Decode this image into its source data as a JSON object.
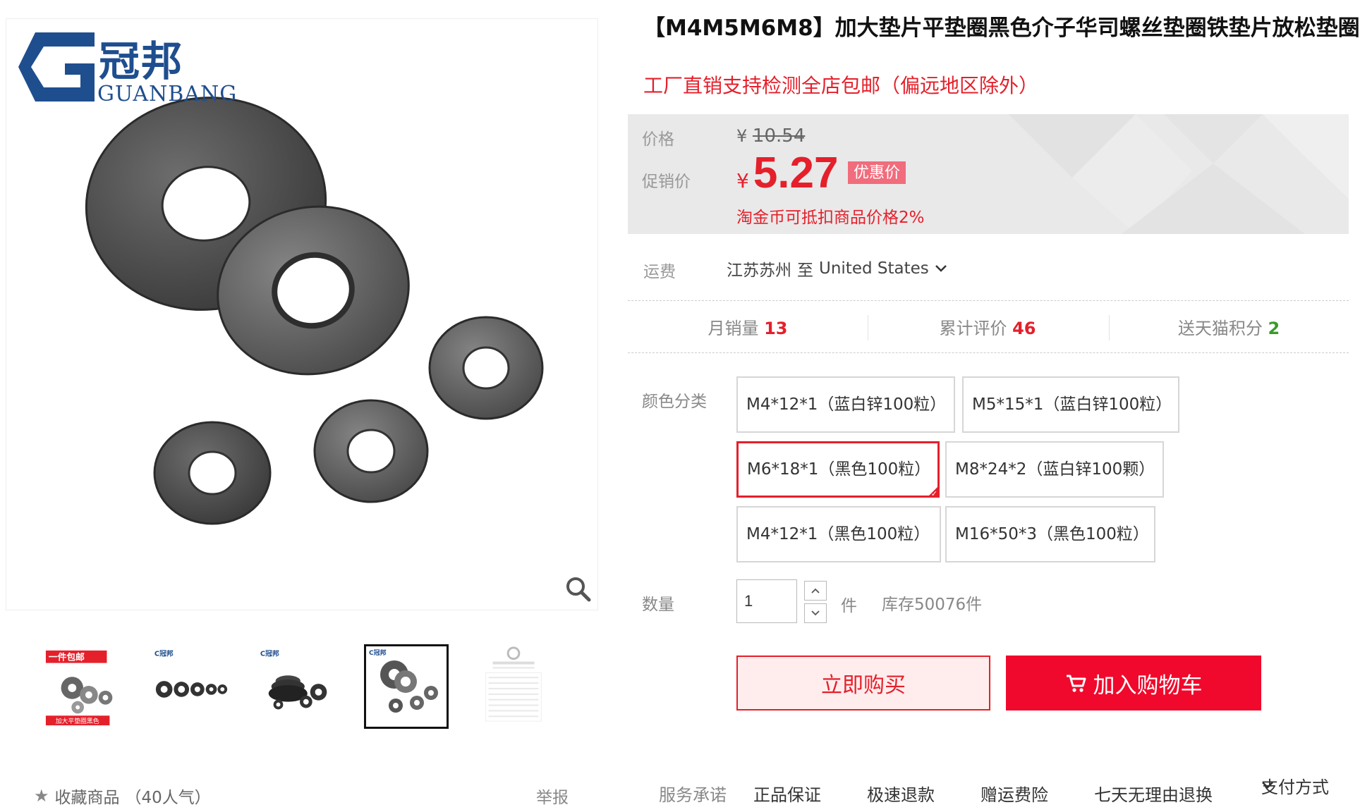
{
  "gallery": {
    "logo_cn": "冠邦",
    "logo_en": "GUANBANG",
    "thumb_promo_text": "一件包邮",
    "thumb_promo_footer": "加大平垫圈黑色",
    "favorite_label": "收藏商品",
    "favorite_count": "（40人气）",
    "report_label": "举报"
  },
  "product": {
    "title": "【M4M5M6M8】加大垫片平垫圈黑色介子华司螺丝垫圈铁垫片放松垫圈",
    "subtitle": "工厂直销支持检测全店包邮（偏远地区除外）",
    "price_label": "价格",
    "original_price_symbol": "¥",
    "original_price": "10.54",
    "promo_label": "促销价",
    "promo_price_symbol": "¥",
    "promo_price": "5.27",
    "promo_badge": "优惠价",
    "coin_note": "淘金币可抵扣商品价格2%"
  },
  "shipping": {
    "label": "运费",
    "from": "江苏苏州",
    "to_word": "至",
    "destination": "United States"
  },
  "stats": [
    {
      "label": "月销量",
      "value": "13"
    },
    {
      "label": "累计评价",
      "value": "46"
    },
    {
      "label": "送天猫积分",
      "value": "2"
    }
  ],
  "sku": {
    "label": "颜色分类",
    "options": [
      "M4*12*1（蓝白锌100粒）",
      "M5*15*1（蓝白锌100粒）",
      "M6*18*1（黑色100粒）",
      "M8*24*2（蓝白锌100颗）",
      "M4*12*1（黑色100粒）",
      "M16*50*3（黑色100粒）"
    ],
    "selected": "M6*18*1（黑色100粒）"
  },
  "quantity": {
    "label": "数量",
    "value": "1",
    "unit": "件",
    "stock": "库存50076件"
  },
  "actions": {
    "buy_now": "立即购买",
    "add_to_cart": "加入购物车"
  },
  "services": {
    "label": "服务承诺",
    "items": [
      "正品保证",
      "极速退款",
      "赠运费险",
      "七天无理由退换"
    ],
    "payment": "支付方式"
  },
  "colors": {
    "accent": "#e4202b",
    "cart_button": "#f0092c",
    "logo_blue": "#1f4e8f"
  }
}
